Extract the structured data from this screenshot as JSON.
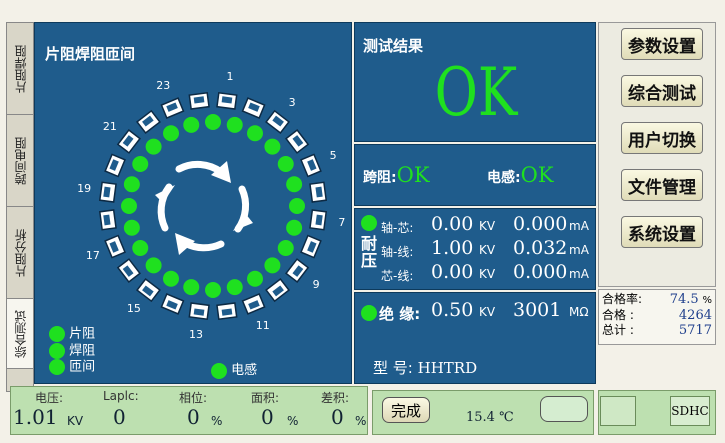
{
  "tabs": [
    "片阻焊阻",
    "跨间电阻",
    "片阻分析",
    "综合测试"
  ],
  "ring": {
    "title": "片阻焊阻匝间",
    "slot_labels": [
      "1",
      "3",
      "5",
      "7",
      "9",
      "11",
      "13",
      "15",
      "17",
      "19",
      "21",
      "23"
    ],
    "legend": [
      {
        "label": "片阻"
      },
      {
        "label": "焊阻"
      },
      {
        "label": "匝间"
      }
    ],
    "inductance_label": "电感"
  },
  "result": {
    "title": "测试结果",
    "status": "OK"
  },
  "span": {
    "label": "跨阻:",
    "value": "OK",
    "ind_label": "电感:",
    "ind_value": "OK"
  },
  "hipot": {
    "label": "耐压",
    "rows": [
      {
        "name": "轴-芯:",
        "voltage": "0.00",
        "vunit": "KV",
        "current": "0.000",
        "cunit": "mA"
      },
      {
        "name": "轴-线:",
        "voltage": "1.00",
        "vunit": "KV",
        "current": "0.032",
        "cunit": "mA"
      },
      {
        "name": "芯-线:",
        "voltage": "0.00",
        "vunit": "KV",
        "current": "0.000",
        "cunit": "mA"
      }
    ]
  },
  "insulation": {
    "label": "绝 缘:",
    "voltage": "0.50",
    "vunit": "KV",
    "resistance": "3001",
    "runit": "MΩ"
  },
  "model": {
    "label": "型 号:",
    "value": "HHTRD"
  },
  "menu": [
    "参数设置",
    "综合测试",
    "用户切换",
    "文件管理",
    "系统设置"
  ],
  "stats": {
    "rate_label": "合格率:",
    "rate": "74.5",
    "rate_unit": "%",
    "pass_label": "合格  :",
    "pass": "4264",
    "total_label": "总计  :",
    "total": "5717"
  },
  "bottom": {
    "labels": [
      "电压:",
      "Laplc:",
      "相位:",
      "面积:",
      "差积:"
    ],
    "voltage": "1.01",
    "voltage_unit": "KV",
    "laplc": "0",
    "phase": "0",
    "phase_unit": "%",
    "area": "0",
    "area_unit": "%",
    "diff": "0",
    "diff_unit": "%",
    "done_label": "完成",
    "temperature": "15.4 ℃",
    "sd_label": "SDHC"
  },
  "colors": {
    "panel": "#1f5c8c",
    "ok": "#1fe01f",
    "background": "#f3f1e8"
  }
}
